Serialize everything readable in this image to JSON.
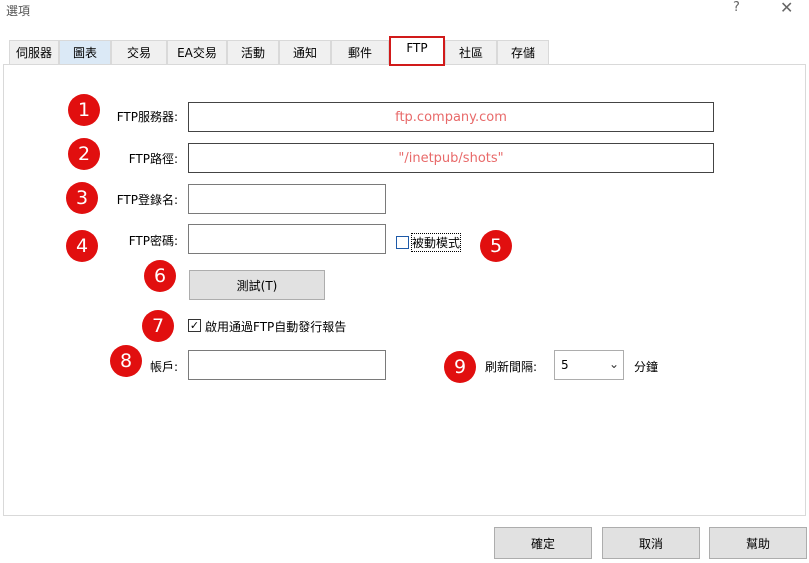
{
  "window": {
    "title": "選項",
    "help_glyph": "?",
    "close_glyph": "✕"
  },
  "tabs": [
    {
      "label": "伺服器"
    },
    {
      "label": "圖表"
    },
    {
      "label": "交易"
    },
    {
      "label": "EA交易"
    },
    {
      "label": "活動"
    },
    {
      "label": "通知"
    },
    {
      "label": "郵件"
    },
    {
      "label": "FTP"
    },
    {
      "label": "社區"
    },
    {
      "label": "存儲"
    }
  ],
  "form": {
    "ftp_server_label": "FTP服務器:",
    "ftp_server_value": "ftp.company.com",
    "ftp_path_label": "FTP路徑:",
    "ftp_path_value": "\"/inetpub/shots\"",
    "ftp_login_label": "FTP登錄名:",
    "ftp_login_value": "",
    "ftp_password_label": "FTP密碼:",
    "ftp_password_value": "",
    "passive_mode_label": "被動模式",
    "test_button_label": "測試(T)",
    "enable_ftp_report_label": "啟用通過FTP自動發行報告",
    "account_label": "帳戶:",
    "account_value": "",
    "refresh_interval_label": "刷新間隔:",
    "refresh_interval_value": "5",
    "refresh_unit_label": "分鐘"
  },
  "annotations": [
    "1",
    "2",
    "3",
    "4",
    "5",
    "6",
    "7",
    "8",
    "9"
  ],
  "footer": {
    "ok_label": "確定",
    "cancel_label": "取消",
    "help_label": "幫助"
  },
  "colors": {
    "annotation_red": "#e10f0f",
    "input_placeholder_red": "#e86a6a",
    "active_tab_border": "#d11a1a"
  }
}
